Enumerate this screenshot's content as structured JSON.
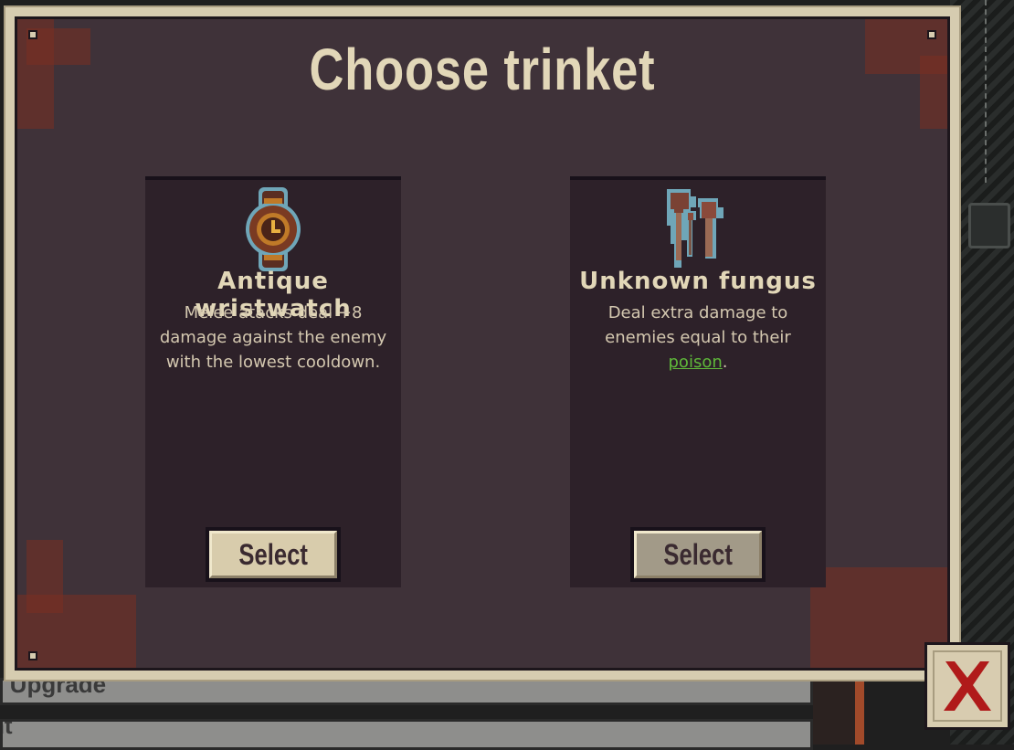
{
  "title": "Choose trinket",
  "trinkets": [
    {
      "name": "Antique wristwatch",
      "description_lines": [
        "Melee atacks deal +8",
        "damage against the enemy",
        "with the lowest cooldown."
      ],
      "icon": "wristwatch-icon",
      "select_label": "Select"
    },
    {
      "name": "Unknown fungus",
      "description_lines": [
        "Deal extra damage to",
        "enemies equal to their"
      ],
      "keyword": "poison",
      "description_end": ".",
      "icon": "mushroom-icon",
      "select_label": "Select"
    }
  ],
  "background": {
    "bar1_text": "y Upgrade",
    "bar2_text": "nt"
  },
  "close_icon": "close-x-icon",
  "colors": {
    "panel": "#3f3239",
    "card": "#2d2129",
    "frame": "#d6ccb0",
    "title": "#e2d7b8",
    "keyword": "#5fb83a",
    "close_x": "#b01a1a"
  }
}
